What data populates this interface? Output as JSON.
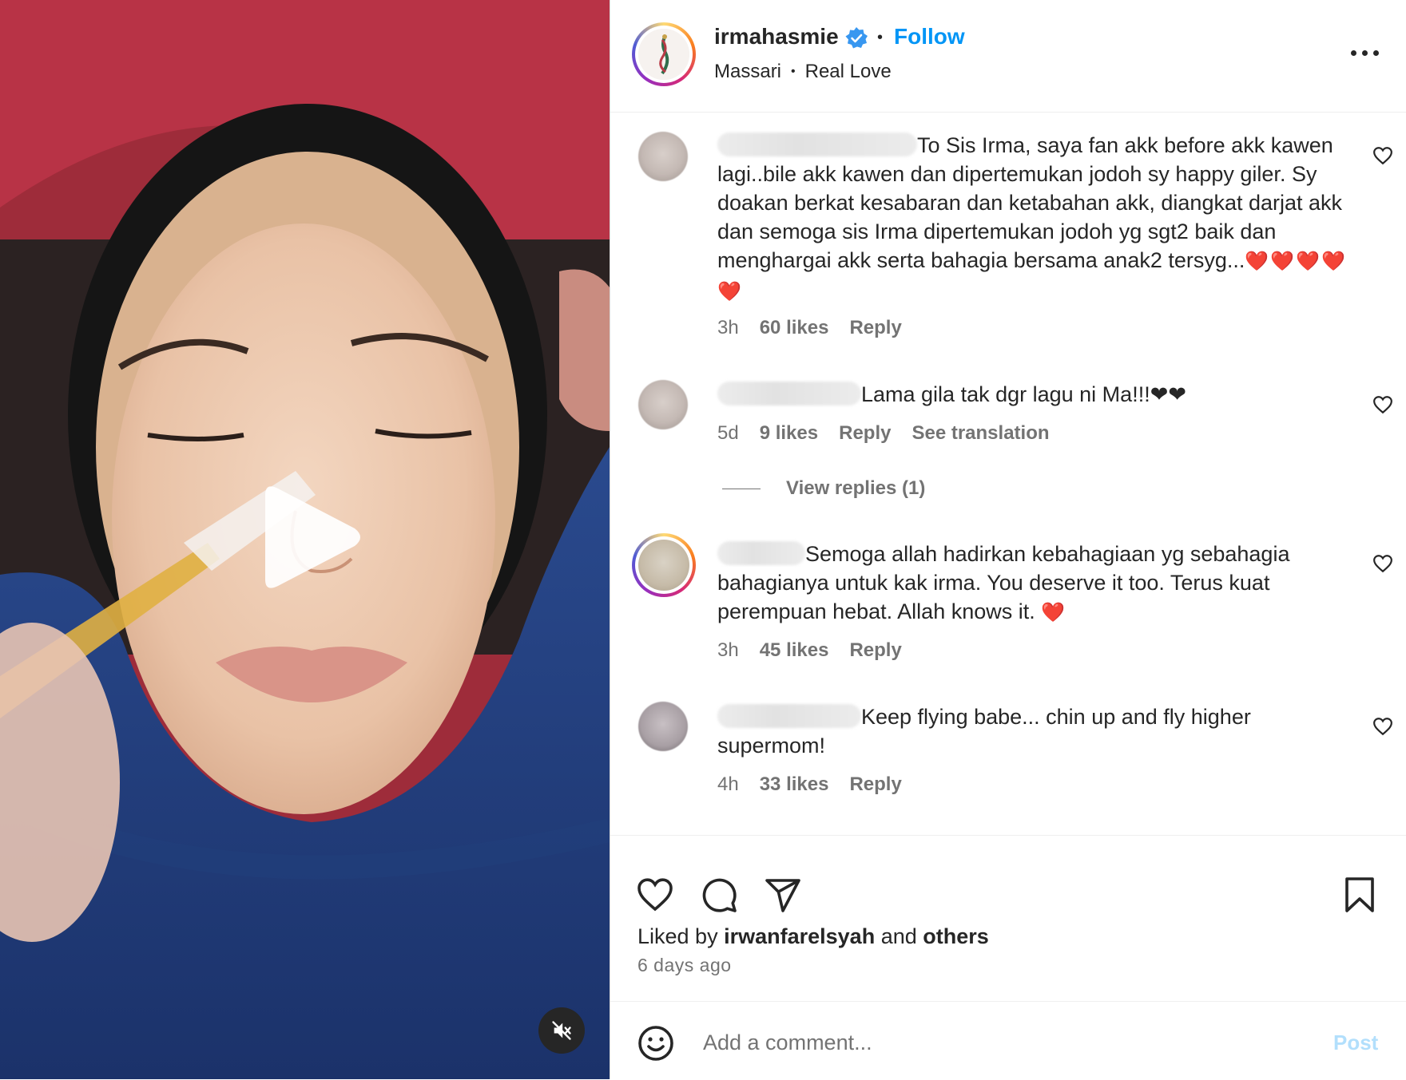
{
  "post": {
    "username": "irmahasmie",
    "follow_label": "Follow",
    "music_artist": "Massari",
    "music_track": "Real Love"
  },
  "comments": [
    {
      "text": "To Sis Irma, saya fan akk before akk kawen lagi..bile akk kawen dan dipertemukan jodoh sy happy giler. Sy doakan berkat kesabaran dan ketabahan akk, diangkat darjat akk dan semoga sis Irma dipertemukan jodoh yg sgt2 baik dan menghargai akk serta bahagia bersama anak2 tersyg...",
      "emoji": "❤️❤️❤️❤️❤️",
      "time": "3h",
      "likes": "60 likes",
      "reply": "Reply"
    },
    {
      "text": "Lama gila tak dgr lagu ni Ma!!!❤❤",
      "time": "5d",
      "likes": "9 likes",
      "reply": "Reply",
      "translate": "See translation",
      "view_replies": "View replies (1)"
    },
    {
      "text": "Semoga allah hadirkan kebahagiaan yg sebahagia bahagianya untuk kak irma. You deserve it too. Terus kuat perempuan hebat. Allah knows it.",
      "emoji": "❤️",
      "time": "3h",
      "likes": "45 likes",
      "reply": "Reply"
    },
    {
      "text": "Keep flying babe... chin up and fly higher supermom!",
      "time": "4h",
      "likes": "33 likes",
      "reply": "Reply"
    }
  ],
  "likes_bar": {
    "prefix": "Liked by",
    "user": "irwanfarelsyah",
    "middle": "and",
    "others": "others",
    "posted_ago": "6 days ago"
  },
  "add_comment": {
    "placeholder": "Add a comment...",
    "post_label": "Post"
  },
  "colors": {
    "follow": "#0095f6",
    "post_disabled": "#b2dffc",
    "heart_red": "#e0245e"
  },
  "icons": [
    "play-icon",
    "mute-icon",
    "verified-badge-icon",
    "more-options-icon",
    "heart-icon",
    "comment-icon",
    "share-icon",
    "bookmark-icon",
    "emoji-icon"
  ]
}
